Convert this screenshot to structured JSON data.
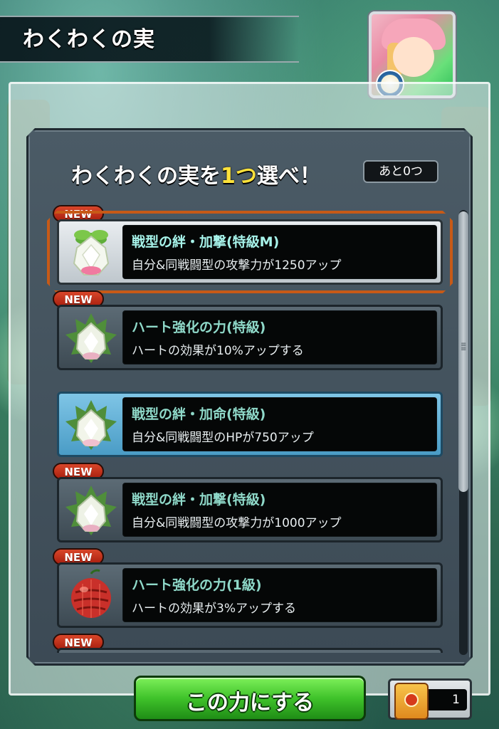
{
  "header": {
    "title": "わくわくの実"
  },
  "selection": {
    "heading_pre": "わくわくの実を",
    "heading_count": "1つ",
    "heading_post": "選べ！",
    "remaining": "あと0つ"
  },
  "badge_label": "NEW",
  "fruits": [
    {
      "name": "戦型の絆・加撃(特級M)",
      "desc": "自分&同戦闘型の攻撃力が1250アップ",
      "new": true,
      "state": "selected",
      "icon": "white-lotus-fruit-icon"
    },
    {
      "name": "ハート強化の力(特級)",
      "desc": "ハートの効果が10%アップする",
      "new": true,
      "state": "normal",
      "icon": "white-lotus-fruit-icon"
    },
    {
      "name": "戦型の絆・加命(特級)",
      "desc": "自分&同戦闘型のHPが750アップ",
      "new": false,
      "state": "highlighted",
      "icon": "white-lotus-fruit-icon"
    },
    {
      "name": "戦型の絆・加撃(特級)",
      "desc": "自分&同戦闘型の攻撃力が1000アップ",
      "new": true,
      "state": "normal",
      "icon": "white-lotus-fruit-icon"
    },
    {
      "name": "ハート強化の力(1級)",
      "desc": "ハートの効果が3%アップする",
      "new": true,
      "state": "normal",
      "icon": "red-fruit-icon"
    },
    {
      "name": "",
      "desc": "",
      "new": true,
      "state": "normal",
      "icon": ""
    }
  ],
  "footer": {
    "confirm_label": "この力にする",
    "item_count": "1"
  },
  "colors": {
    "selected_border": "#c75a17",
    "highlight_card": "#7fc5e6",
    "new_badge": "#d9462a",
    "confirm_button": "#3fc22a",
    "heading_accent": "#ffe23a"
  }
}
